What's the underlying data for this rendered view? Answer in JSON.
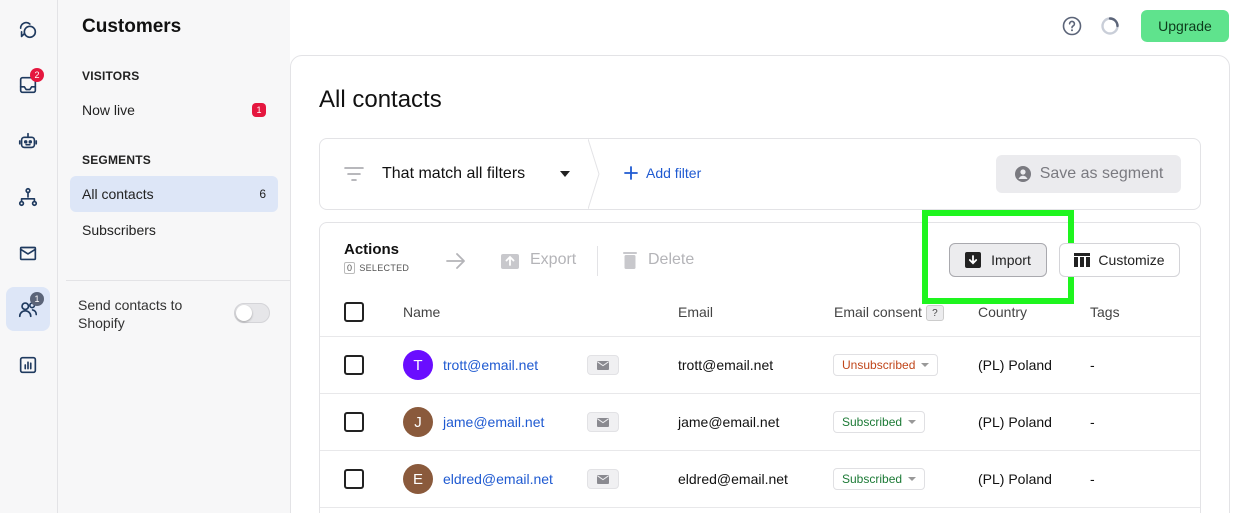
{
  "rail": {
    "inbox_badge": "2",
    "customers_badge": "1"
  },
  "sidebar": {
    "title": "Customers",
    "visitors_header": "VISITORS",
    "now_live_label": "Now live",
    "now_live_count": "1",
    "segments_header": "SEGMENTS",
    "all_contacts_label": "All contacts",
    "all_contacts_count": "6",
    "subscribers_label": "Subscribers",
    "shopify_label": "Send contacts to Shopify",
    "shopify_enabled": false
  },
  "topbar": {
    "upgrade_label": "Upgrade",
    "upgrade_color": "#5fe38d"
  },
  "main": {
    "title": "All contacts",
    "filter_label": "That match all filters",
    "add_filter_label": "Add filter",
    "save_segment_label": "Save as segment"
  },
  "actions": {
    "title": "Actions",
    "selected_count": "0",
    "selected_label": "SELECTED",
    "export_label": "Export",
    "delete_label": "Delete",
    "import_label": "Import",
    "customize_label": "Customize"
  },
  "table": {
    "headers": {
      "name": "Name",
      "email": "Email",
      "consent": "Email consent",
      "consent_help": "?",
      "country": "Country",
      "tags": "Tags"
    },
    "rows": [
      {
        "initial": "T",
        "avatar_color": "#6a0dff",
        "name": "trott@email.net",
        "email": "trott@email.net",
        "consent": "Unsubscribed",
        "consent_color": "#c0461a",
        "country": "(PL) Poland",
        "tags": "-"
      },
      {
        "initial": "J",
        "avatar_color": "#8a5a3c",
        "name": "jame@email.net",
        "email": "jame@email.net",
        "consent": "Subscribed",
        "consent_color": "#1c7a36",
        "country": "(PL) Poland",
        "tags": "-"
      },
      {
        "initial": "E",
        "avatar_color": "#8a5a3c",
        "name": "eldred@email.net",
        "email": "eldred@email.net",
        "consent": "Subscribed",
        "consent_color": "#1c7a36",
        "country": "(PL) Poland",
        "tags": "-"
      }
    ]
  }
}
